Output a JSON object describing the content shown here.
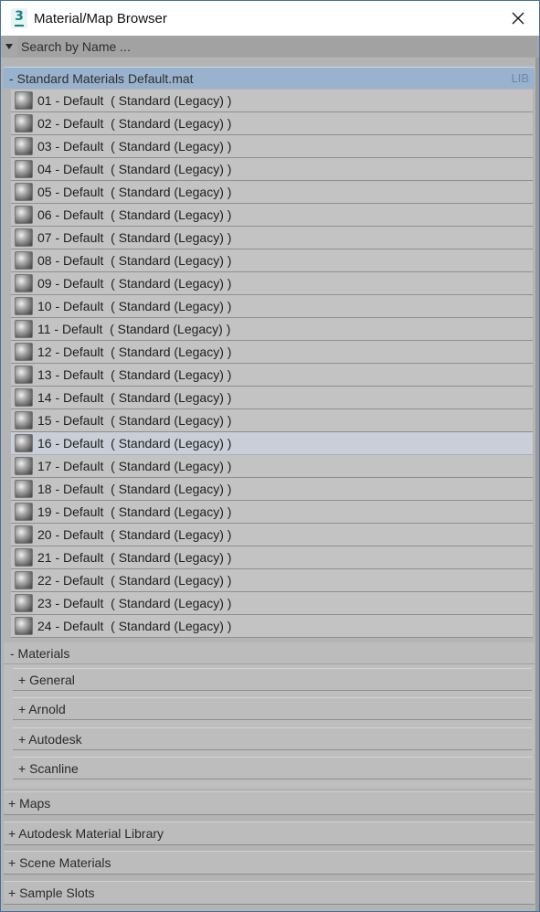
{
  "window": {
    "title": "Material/Map Browser",
    "app_icon_glyph": "3",
    "close_icon": "close-icon"
  },
  "search": {
    "placeholder": "Search by Name ..."
  },
  "library": {
    "header": "- Standard Materials Default.mat",
    "tag": "LIB",
    "items": [
      {
        "name": "01 - Default  ( Standard (Legacy) )"
      },
      {
        "name": "02 - Default  ( Standard (Legacy) )"
      },
      {
        "name": "03 - Default  ( Standard (Legacy) )"
      },
      {
        "name": "04 - Default  ( Standard (Legacy) )"
      },
      {
        "name": "05 - Default  ( Standard (Legacy) )"
      },
      {
        "name": "06 - Default  ( Standard (Legacy) )"
      },
      {
        "name": "07 - Default  ( Standard (Legacy) )"
      },
      {
        "name": "08 - Default  ( Standard (Legacy) )"
      },
      {
        "name": "09 - Default  ( Standard (Legacy) )"
      },
      {
        "name": "10 - Default  ( Standard (Legacy) )"
      },
      {
        "name": "11 - Default  ( Standard (Legacy) )"
      },
      {
        "name": "12 - Default  ( Standard (Legacy) )"
      },
      {
        "name": "13 - Default  ( Standard (Legacy) )"
      },
      {
        "name": "14 - Default  ( Standard (Legacy) )"
      },
      {
        "name": "15 - Default  ( Standard (Legacy) )"
      },
      {
        "name": "16 - Default  ( Standard (Legacy) )",
        "selected": true
      },
      {
        "name": "17 - Default  ( Standard (Legacy) )"
      },
      {
        "name": "18 - Default  ( Standard (Legacy) )"
      },
      {
        "name": "19 - Default  ( Standard (Legacy) )"
      },
      {
        "name": "20 - Default  ( Standard (Legacy) )"
      },
      {
        "name": "21 - Default  ( Standard (Legacy) )"
      },
      {
        "name": "22 - Default  ( Standard (Legacy) )"
      },
      {
        "name": "23 - Default  ( Standard (Legacy) )"
      },
      {
        "name": "24 - Default  ( Standard (Legacy) )"
      }
    ]
  },
  "materials_group": {
    "header": "- Materials",
    "subgroups": [
      {
        "label": "+ General"
      },
      {
        "label": "+ Arnold"
      },
      {
        "label": "+ Autodesk"
      },
      {
        "label": "+ Scanline"
      }
    ]
  },
  "rollouts": [
    {
      "label": "+ Maps"
    },
    {
      "label": "+ Autodesk Material Library"
    },
    {
      "label": "+ Scene Materials"
    },
    {
      "label": "+ Sample Slots"
    }
  ],
  "colors": {
    "selected_library": "#99b2cd",
    "selected_row": "#c9ced8",
    "panel_bg": "#b4b4b4"
  }
}
